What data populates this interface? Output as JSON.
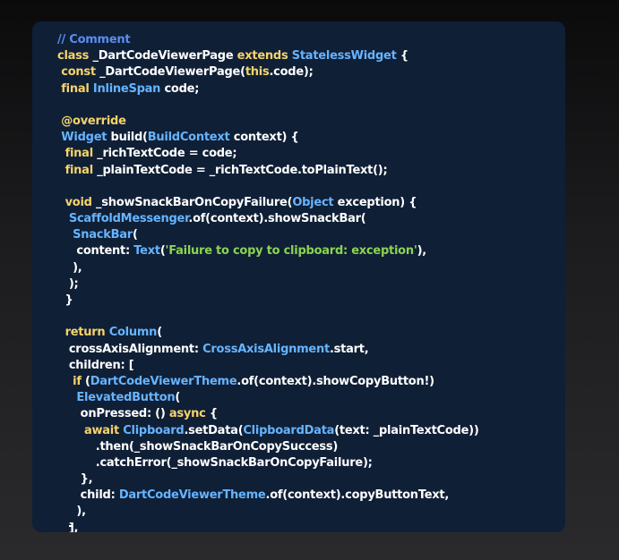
{
  "code_viewer": {
    "lines": [
      [
        [
          "cm",
          "// Comment"
        ]
      ],
      [
        [
          "kw",
          "class "
        ],
        [
          "tx",
          "_DartCodeViewerPage "
        ],
        [
          "kw",
          "extends "
        ],
        [
          "ty",
          "StatelessWidget"
        ],
        [
          "tx",
          " {"
        ]
      ],
      [
        [
          "tx",
          " "
        ],
        [
          "kw",
          "const "
        ],
        [
          "tx",
          "_DartCodeViewerPage("
        ],
        [
          "kw",
          "this"
        ],
        [
          "tx",
          ".code);"
        ]
      ],
      [
        [
          "tx",
          " "
        ],
        [
          "kw",
          "final "
        ],
        [
          "ty",
          "InlineSpan"
        ],
        [
          "tx",
          " code;"
        ]
      ],
      [
        [
          "tx",
          ""
        ]
      ],
      [
        [
          "tx",
          " "
        ],
        [
          "kw",
          "@override"
        ]
      ],
      [
        [
          "tx",
          " "
        ],
        [
          "ty",
          "Widget"
        ],
        [
          "tx",
          " build("
        ],
        [
          "ty",
          "BuildContext"
        ],
        [
          "tx",
          " context) {"
        ]
      ],
      [
        [
          "tx",
          "  "
        ],
        [
          "kw",
          "final "
        ],
        [
          "tx",
          "_richTextCode = code;"
        ]
      ],
      [
        [
          "tx",
          "  "
        ],
        [
          "kw",
          "final "
        ],
        [
          "tx",
          "_plainTextCode = _richTextCode.toPlainText();"
        ]
      ],
      [
        [
          "tx",
          ""
        ]
      ],
      [
        [
          "tx",
          "  "
        ],
        [
          "kw",
          "void "
        ],
        [
          "tx",
          "_showSnackBarOnCopyFailure("
        ],
        [
          "ty",
          "Object"
        ],
        [
          "tx",
          " exception) {"
        ]
      ],
      [
        [
          "tx",
          "   "
        ],
        [
          "ty",
          "ScaffoldMessenger"
        ],
        [
          "tx",
          ".of(context).showSnackBar("
        ]
      ],
      [
        [
          "tx",
          "    "
        ],
        [
          "ty",
          "SnackBar"
        ],
        [
          "tx",
          "("
        ]
      ],
      [
        [
          "tx",
          "     content: "
        ],
        [
          "ty",
          "Text"
        ],
        [
          "tx",
          "("
        ],
        [
          "st",
          "'Failure to copy to clipboard: exception'"
        ],
        [
          "tx",
          "),"
        ]
      ],
      [
        [
          "tx",
          "    ),"
        ]
      ],
      [
        [
          "tx",
          "   );"
        ]
      ],
      [
        [
          "tx",
          "  }"
        ]
      ],
      [
        [
          "tx",
          ""
        ]
      ],
      [
        [
          "tx",
          "  "
        ],
        [
          "kw",
          "return "
        ],
        [
          "ty",
          "Column"
        ],
        [
          "tx",
          "("
        ]
      ],
      [
        [
          "tx",
          "   crossAxisAlignment: "
        ],
        [
          "ty",
          "CrossAxisAlignment"
        ],
        [
          "tx",
          ".start,"
        ]
      ],
      [
        [
          "tx",
          "   children: ["
        ]
      ],
      [
        [
          "tx",
          "    "
        ],
        [
          "kw",
          "if "
        ],
        [
          "tx",
          "("
        ],
        [
          "ty",
          "DartCodeViewerTheme"
        ],
        [
          "tx",
          ".of(context).showCopyButton!)"
        ]
      ],
      [
        [
          "tx",
          "     "
        ],
        [
          "ty",
          "ElevatedButton"
        ],
        [
          "tx",
          "("
        ]
      ],
      [
        [
          "tx",
          "      onPressed: () "
        ],
        [
          "kw",
          "async"
        ],
        [
          "tx",
          " {"
        ]
      ],
      [
        [
          "tx",
          "       "
        ],
        [
          "kw",
          "await "
        ],
        [
          "ty",
          "Clipboard"
        ],
        [
          "tx",
          ".setData("
        ],
        [
          "ty",
          "ClipboardData"
        ],
        [
          "tx",
          "(text: _plainTextCode))"
        ]
      ],
      [
        [
          "tx",
          "          .then(_showSnackBarOnCopySuccess)"
        ]
      ],
      [
        [
          "tx",
          "          .catchError(_showSnackBarOnCopyFailure);"
        ]
      ],
      [
        [
          "tx",
          "      },"
        ]
      ],
      [
        [
          "tx",
          "      child: "
        ],
        [
          "ty",
          "DartCodeViewerTheme"
        ],
        [
          "tx",
          ".of(context).copyButtonText,"
        ]
      ],
      [
        [
          "tx",
          "     ),"
        ]
      ],
      [
        [
          "tx",
          "   ],"
        ]
      ]
    ]
  }
}
